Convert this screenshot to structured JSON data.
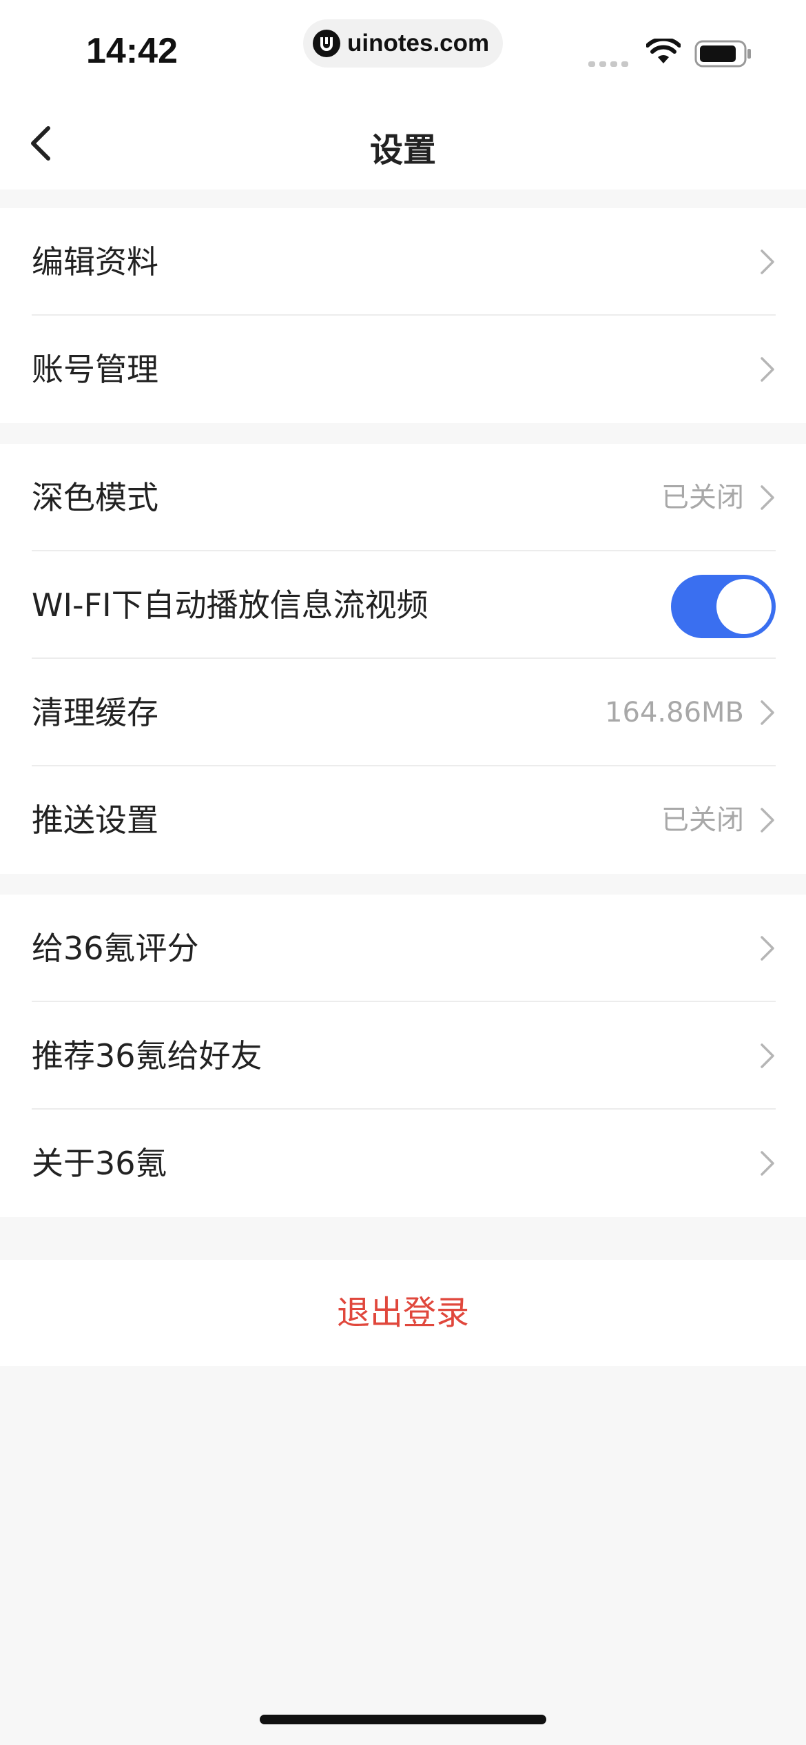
{
  "status_bar": {
    "time": "14:42",
    "url": "uinotes.com"
  },
  "nav": {
    "title": "设置"
  },
  "groups": [
    {
      "rows": [
        {
          "label": "编辑资料"
        },
        {
          "label": "账号管理"
        }
      ]
    },
    {
      "rows": [
        {
          "label": "深色模式",
          "value": "已关闭"
        },
        {
          "label": "WI-FI下自动播放信息流视频",
          "toggle_on": true
        },
        {
          "label": "清理缓存",
          "value": "164.86MB"
        },
        {
          "label": "推送设置",
          "value": "已关闭"
        }
      ]
    },
    {
      "rows": [
        {
          "label": "给36氪评分"
        },
        {
          "label": "推荐36氪给好友"
        },
        {
          "label": "关于36氪"
        }
      ]
    }
  ],
  "logout": {
    "label": "退出登录"
  },
  "colors": {
    "accent": "#3a6ff0",
    "danger": "#e0473c",
    "background": "#f7f7f7"
  }
}
